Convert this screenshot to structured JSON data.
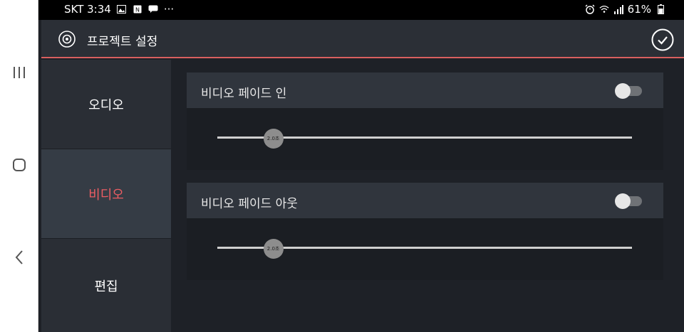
{
  "statusbar": {
    "carrier_time": "SKT 3:34",
    "more": "···",
    "battery": "61%",
    "icons": [
      "image-icon",
      "nfc-icon",
      "chat-icon",
      "alarm-icon",
      "wifi-icon",
      "signal-icon",
      "battery-icon"
    ]
  },
  "header": {
    "title": "프로젝트 설정",
    "icon": "settings-circle-icon",
    "done_icon": "check-circle-icon"
  },
  "sidebar": {
    "items": [
      {
        "label": "오디오",
        "active": false
      },
      {
        "label": "비디오",
        "active": true
      },
      {
        "label": "편집",
        "active": false
      }
    ]
  },
  "panels": [
    {
      "label": "비디오 페이드 인",
      "toggle_on": false,
      "slider_value": 0.135,
      "slider_thumb_label": "2.0초"
    },
    {
      "label": "비디오 페이드 아웃",
      "toggle_on": false,
      "slider_value": 0.135,
      "slider_thumb_label": "2.0초"
    }
  ],
  "colors": {
    "accent": "#ec5d63",
    "background": "#1e2127",
    "panel_header": "#30353d"
  }
}
